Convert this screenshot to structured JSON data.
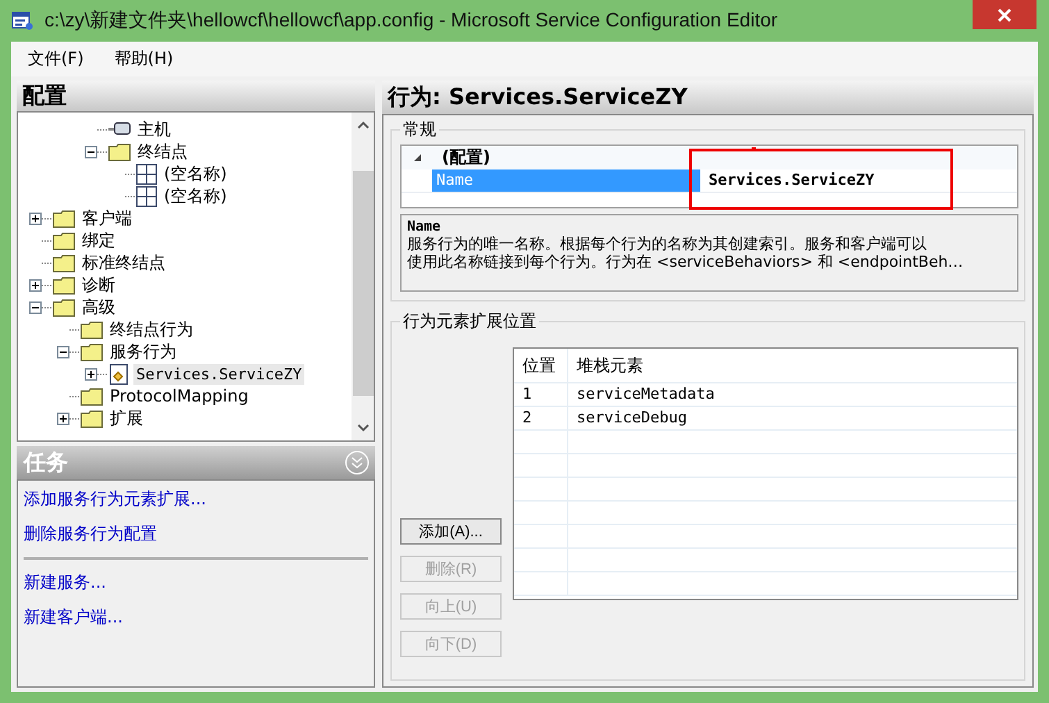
{
  "window": {
    "title": "c:\\zy\\新建文件夹\\hellowcf\\hellowcf\\app.config - Microsoft Service Configuration Editor"
  },
  "menu": [
    "文件(F)",
    "帮助(H)"
  ],
  "config_panel": {
    "title": "配置",
    "tree": [
      {
        "children": [
          {
            "children": [
              {
                "label": "主机",
                "kind": "host"
              },
              {
                "label": "终结点",
                "kind": "folder",
                "expanded": true,
                "children": [
                  {
                    "label": "(空名称)",
                    "kind": "endpoint"
                  },
                  {
                    "label": "(空名称)",
                    "kind": "endpoint"
                  }
                ]
              }
            ]
          }
        ]
      },
      {
        "label": "客户端",
        "kind": "folder",
        "expanded": false
      },
      {
        "label": "绑定",
        "kind": "folder"
      },
      {
        "label": "标准终结点",
        "kind": "folder"
      },
      {
        "label": "诊断",
        "kind": "folder",
        "expanded": false
      },
      {
        "label": "高级",
        "kind": "folder",
        "expanded": true,
        "children": [
          {
            "label": "终结点行为",
            "kind": "folder"
          },
          {
            "label": "服务行为",
            "kind": "folder",
            "expanded": true,
            "children": [
              {
                "label": "Services.ServiceZY",
                "kind": "behavior",
                "expanded": false,
                "selected": true
              }
            ]
          },
          {
            "label": "ProtocolMapping",
            "kind": "folder"
          },
          {
            "label": "扩展",
            "kind": "folder",
            "expanded": false
          }
        ]
      }
    ]
  },
  "tasks_panel": {
    "title": "任务",
    "groups": [
      [
        "添加服务行为元素扩展...",
        "删除服务行为配置"
      ],
      [
        "新建服务...",
        "新建客户端..."
      ]
    ]
  },
  "detail": {
    "title": "行为: Services.ServiceZY",
    "general": {
      "title": "常规",
      "category": "(配置)",
      "expanded": true,
      "property": {
        "name": "Name",
        "value": "Services.ServiceZY",
        "selected": true
      },
      "description": {
        "title": "Name",
        "lines": [
          "服务行为的唯一名称。根据每个行为的名称为其创建索引。服务和客户端可以",
          "使用此名称链接到每个行为。行为在  <serviceBehaviors> 和 <endpointBeh…"
        ]
      }
    },
    "extensions": {
      "title": "行为元素扩展位置",
      "buttons": [
        {
          "label": "添加(A)...",
          "disabled": false
        },
        {
          "label": "删除(R)",
          "disabled": true
        },
        {
          "label": "向上(U)",
          "disabled": true
        },
        {
          "label": "向下(D)",
          "disabled": true
        }
      ],
      "columns": [
        "位置",
        "堆栈元素"
      ],
      "rows": [
        [
          "1",
          "serviceMetadata"
        ],
        [
          "2",
          "serviceDebug"
        ]
      ]
    }
  }
}
